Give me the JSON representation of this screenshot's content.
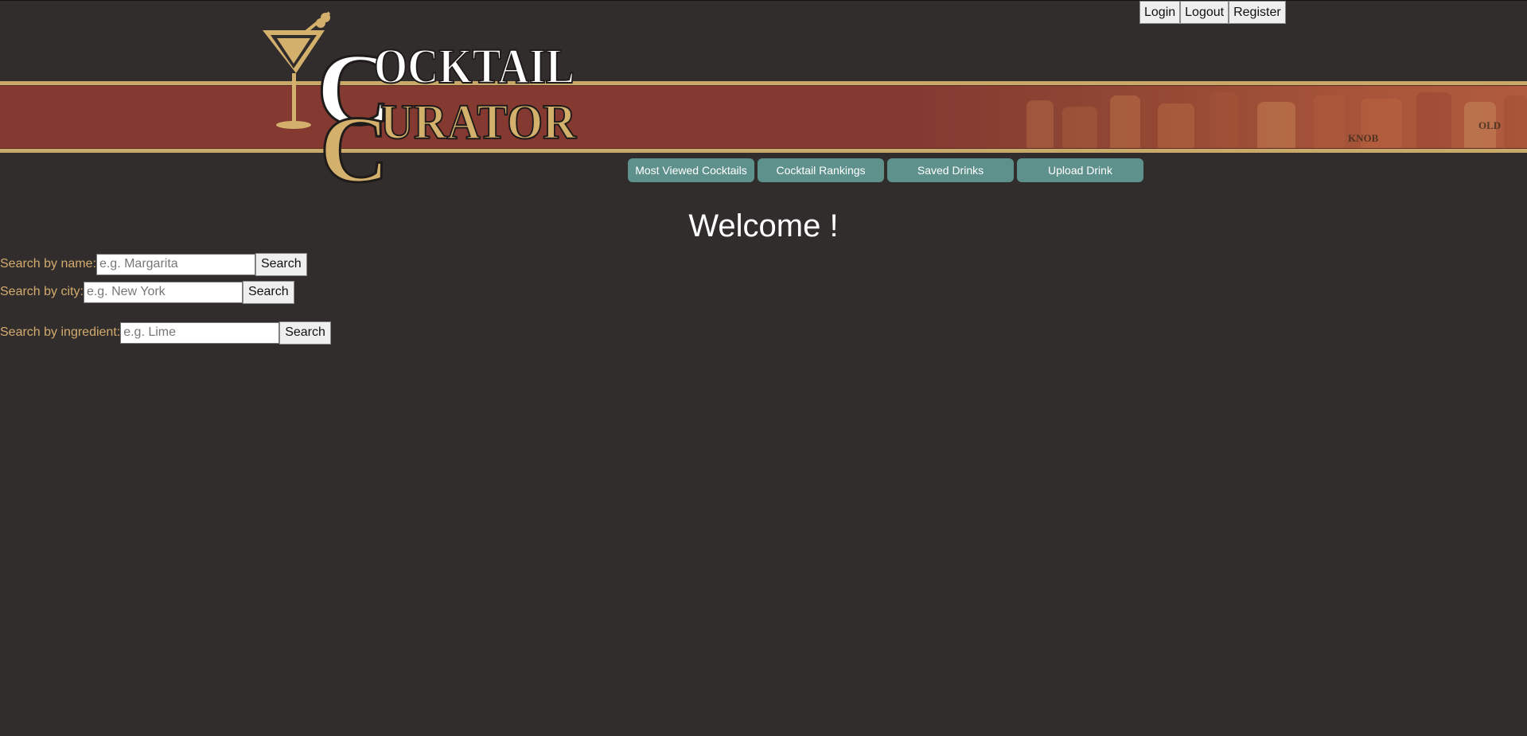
{
  "auth": {
    "login_label": "Login",
    "logout_label": "Logout",
    "register_label": "Register"
  },
  "logo": {
    "line1": "OCKTAIL",
    "line2": "URATOR",
    "initial1": "C",
    "initial2": "C",
    "bottle_labels": [
      "KNOB",
      "OLD"
    ]
  },
  "nav": {
    "items": [
      {
        "label": "Most Viewed Cocktails"
      },
      {
        "label": "Cocktail Rankings"
      },
      {
        "label": "Saved Drinks"
      },
      {
        "label": "Upload Drink"
      }
    ]
  },
  "main": {
    "welcome": "Welcome !"
  },
  "search": {
    "name": {
      "label": "Search by name:",
      "placeholder": "e.g. Margarita",
      "button": "Search"
    },
    "city": {
      "label": "Search by city:",
      "placeholder": "e.g. New York",
      "button": "Search"
    },
    "ingredient": {
      "label": "Search by ingredient:",
      "placeholder": "e.g. Lime",
      "button": "Search"
    }
  },
  "colors": {
    "background": "#312d2c",
    "banner_red": "#843a31",
    "gold": "#c9a96a",
    "nav_button": "#5f918c",
    "search_label": "#d3ab6e"
  }
}
